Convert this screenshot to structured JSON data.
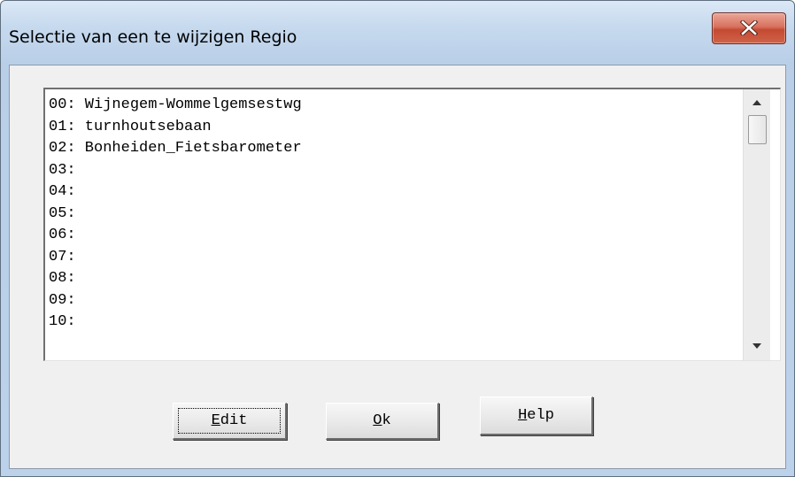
{
  "window": {
    "title": "Selectie van een te wijzigen Regio"
  },
  "icons": {
    "close": "close-x-icon",
    "scroll_up": "triangle-up-icon",
    "scroll_down": "triangle-down-icon"
  },
  "list": {
    "items": [
      "00: Wijnegem-Wommelgemsestwg",
      "01: turnhoutsebaan",
      "02: Bonheiden_Fietsbarometer",
      "03:",
      "04:",
      "05:",
      "06:",
      "07:",
      "08:",
      "09:",
      "10:"
    ]
  },
  "buttons": {
    "edit": {
      "mnemonic": "E",
      "rest": "dit"
    },
    "ok": {
      "mnemonic": "O",
      "rest": "k"
    },
    "help": {
      "mnemonic": "H",
      "rest": "elp"
    }
  },
  "colors": {
    "close_button": "#c44a32",
    "title_bar": "#c6d9ee",
    "dialog_face": "#f0f0f0"
  }
}
